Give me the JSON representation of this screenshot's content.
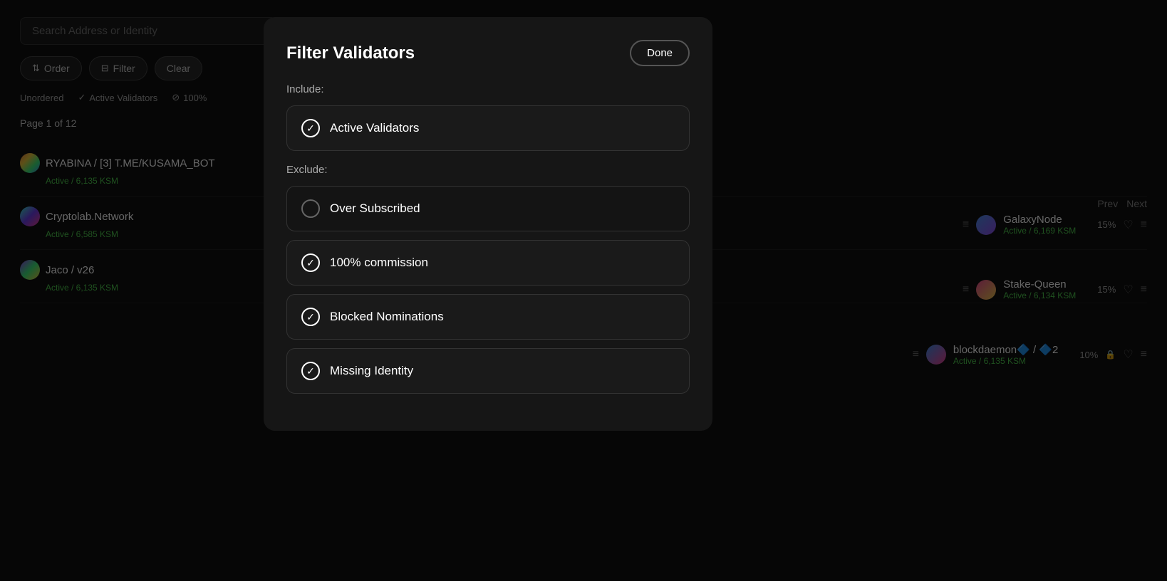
{
  "search": {
    "placeholder": "Search Address or Identity"
  },
  "toolbar": {
    "order_label": "Order",
    "filter_label": "Filter",
    "clear_label": "Clear"
  },
  "filter_bar": {
    "order_value": "Unordered",
    "active_validators": "Active Validators",
    "commission": "100%"
  },
  "pagination": {
    "label": "Page 1 of 12",
    "prev": "Prev",
    "next": "Next"
  },
  "validators_left": [
    {
      "name": "RYABINA / [3] T.ME/KUSAMA_BOT",
      "status": "Active / 6,135 KSM"
    },
    {
      "name": "Cryptolab.Network",
      "status": "Active / 6,585 KSM"
    },
    {
      "name": "Jaco / v26",
      "status": "Active / 6,135 KSM"
    }
  ],
  "validators_right": [
    {
      "name": "GalaxyNode",
      "status": "Active / 6,169 KSM",
      "commission": "15%"
    },
    {
      "name": "Stake-Queen",
      "status": "Active / 6,134 KSM",
      "commission": "15%"
    },
    {
      "name": "blockdaemon🔷 / 🔷2",
      "status": "Active / 6,135 KSM",
      "commission": "10%"
    }
  ],
  "modal": {
    "title": "Filter Validators",
    "done_label": "Done",
    "include_label": "Include:",
    "exclude_label": "Exclude:",
    "include_options": [
      {
        "id": "active-validators",
        "label": "Active Validators",
        "checked": true
      }
    ],
    "exclude_options": [
      {
        "id": "over-subscribed",
        "label": "Over Subscribed",
        "checked": false
      },
      {
        "id": "commission-100",
        "label": "100% commission",
        "checked": true
      },
      {
        "id": "blocked-nominations",
        "label": "Blocked Nominations",
        "checked": true
      },
      {
        "id": "missing-identity",
        "label": "Missing Identity",
        "checked": true
      }
    ]
  }
}
